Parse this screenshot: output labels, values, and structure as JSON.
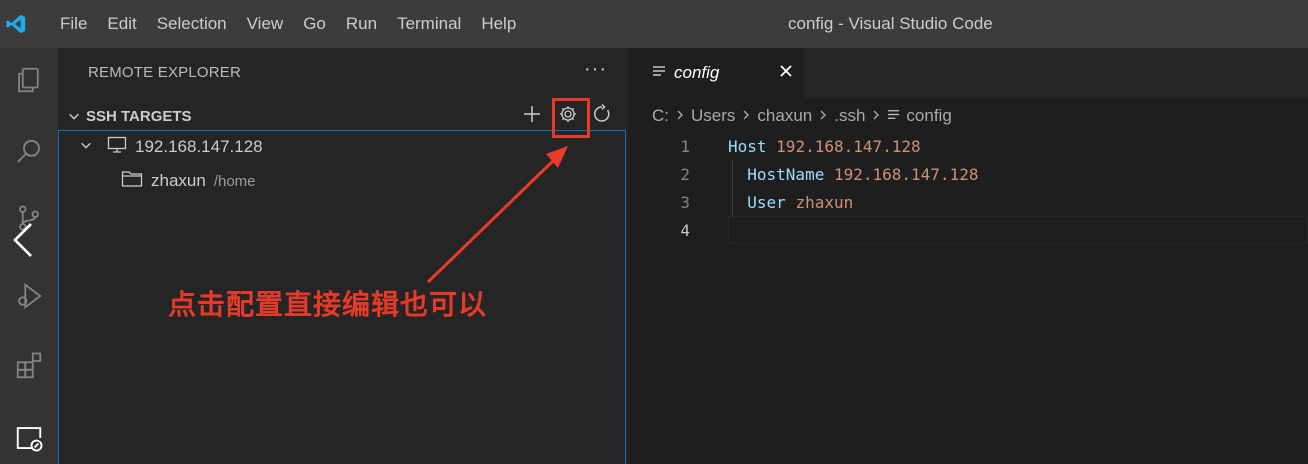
{
  "titlebar": {
    "menu": [
      "File",
      "Edit",
      "Selection",
      "View",
      "Go",
      "Run",
      "Terminal",
      "Help"
    ],
    "window_title": "config - Visual Studio Code"
  },
  "activitybar": {
    "icons": [
      "explorer-icon",
      "search-icon",
      "source-control-icon",
      "run-debug-icon",
      "extensions-icon",
      "remote-explorer-icon"
    ]
  },
  "sidebar": {
    "header": "REMOTE EXPLORER",
    "more": "···",
    "section_title": "SSH TARGETS",
    "host_label": "192.168.147.128",
    "folder_label": "zhaxun",
    "folder_desc": "/home"
  },
  "annotation": {
    "text": "点击配置直接编辑也可以",
    "color": "#e43a2a"
  },
  "editor": {
    "tab_label": "config",
    "breadcrumb": [
      "C:",
      "Users",
      "chaxun",
      ".ssh",
      "config"
    ],
    "lines": [
      {
        "num": "1",
        "key": "Host",
        "value": "192.168.147.128",
        "indent": ""
      },
      {
        "num": "2",
        "key": "HostName",
        "value": "192.168.147.128",
        "indent": "  "
      },
      {
        "num": "3",
        "key": "User",
        "value": "zhaxun",
        "indent": "  "
      },
      {
        "num": "4",
        "key": "",
        "value": "",
        "indent": ""
      }
    ]
  },
  "colors": {
    "accent": "#0e70c0",
    "highlight": "#e83a2c",
    "keyword": "#9cdcfe",
    "string": "#ce9178"
  }
}
